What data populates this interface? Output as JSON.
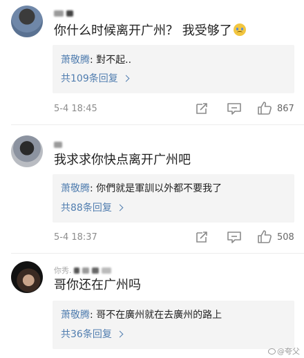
{
  "comments": [
    {
      "text": "你什么时候离开广州？ 我受够了",
      "reply": {
        "author": "萧敬腾",
        "text": ": 對不起.."
      },
      "reply_count": "共109条回复",
      "timestamp": "5-4 18:45",
      "likes": "867"
    },
    {
      "text": "我求求你快点离开广州吧",
      "reply": {
        "author": "萧敬腾",
        "text": ": 你們就是軍訓以外都不要我了"
      },
      "reply_count": "共88条回复",
      "timestamp": "5-4 18:37",
      "likes": "508"
    },
    {
      "username_fragment": "你秀.",
      "text": "哥你还在广州吗",
      "reply": {
        "author": "萧敬腾",
        "text": ": 哥不在廣州就在去廣州的路上"
      },
      "reply_count": "共36条回复"
    }
  ],
  "watermark": "@夸父",
  "colors": {
    "link": "#507daf",
    "reply_bg": "#f4f4f4",
    "meta": "#8c8c8c"
  },
  "icons": [
    "share-icon",
    "comment-icon",
    "like-icon"
  ]
}
